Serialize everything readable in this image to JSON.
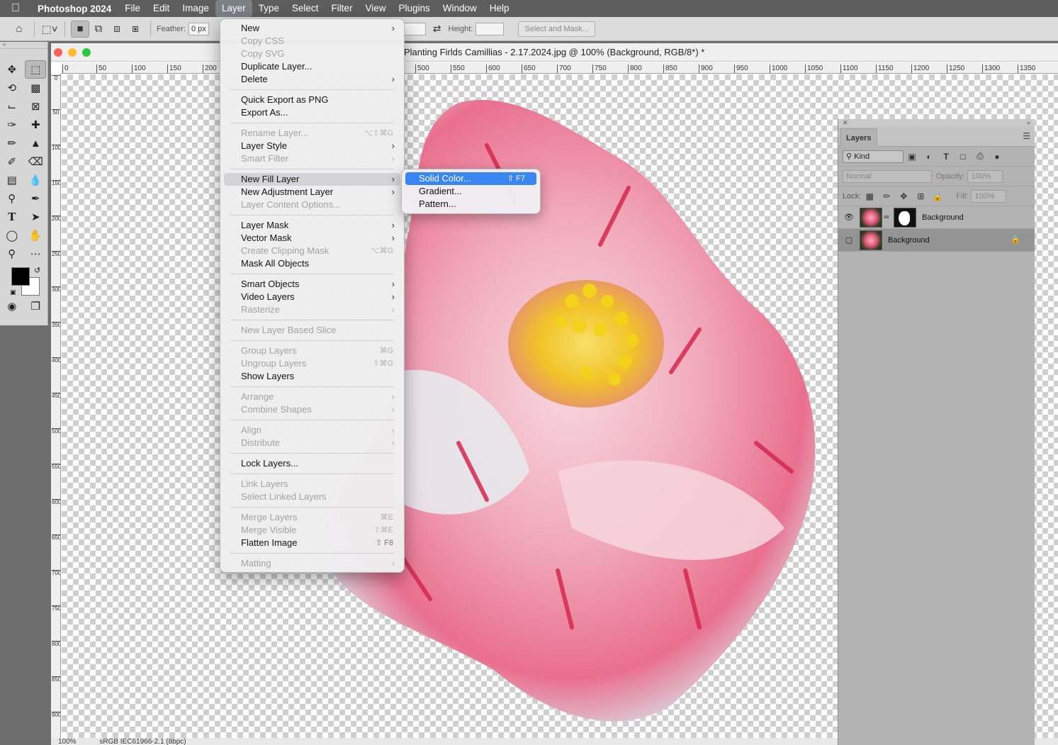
{
  "menubar": {
    "app_name": "Photoshop 2024",
    "items": [
      "File",
      "Edit",
      "Image",
      "Layer",
      "Type",
      "Select",
      "Filter",
      "View",
      "Plugins",
      "Window",
      "Help"
    ],
    "active_item": "Layer"
  },
  "options_bar": {
    "feather_label": "Feather:",
    "feather_value": "0 px",
    "height_label": "Height:",
    "select_mask_label": "Select and Mask..."
  },
  "document": {
    "title": "Planting Firlds Camillias - 2.17.2024.jpg @ 100% (Background, RGB/8*) *",
    "ruler_h": [
      "0",
      "50",
      "100",
      "150",
      "200",
      "500",
      "550",
      "600",
      "650",
      "700",
      "750",
      "800",
      "850",
      "900",
      "950",
      "1000",
      "1050",
      "1100",
      "1150",
      "1200",
      "1250",
      "1300",
      "1350"
    ],
    "ruler_v": [
      "0",
      "50",
      "100",
      "150",
      "200",
      "250",
      "300",
      "350",
      "400",
      "450",
      "500",
      "550",
      "600",
      "650",
      "700",
      "750",
      "800",
      "850",
      "900"
    ],
    "status_zoom": "100%",
    "status_profile": "sRGB IEC61966-2.1 (8bpc)"
  },
  "layer_menu": {
    "groups": [
      [
        {
          "label": "New",
          "arrow": true
        },
        {
          "label": "Copy CSS",
          "disabled": true
        },
        {
          "label": "Copy SVG",
          "disabled": true
        },
        {
          "label": "Duplicate Layer..."
        },
        {
          "label": "Delete",
          "arrow": true
        }
      ],
      [
        {
          "label": "Quick Export as PNG"
        },
        {
          "label": "Export As..."
        }
      ],
      [
        {
          "label": "Rename Layer...",
          "disabled": true,
          "shortcut": "⌥⇧⌘G"
        },
        {
          "label": "Layer Style",
          "arrow": true
        },
        {
          "label": "Smart Filter",
          "disabled": true,
          "arrow": true
        }
      ],
      [
        {
          "label": "New Fill Layer",
          "arrow": true,
          "highlight": true
        },
        {
          "label": "New Adjustment Layer",
          "arrow": true
        },
        {
          "label": "Layer Content Options...",
          "disabled": true
        }
      ],
      [
        {
          "label": "Layer Mask",
          "arrow": true
        },
        {
          "label": "Vector Mask",
          "arrow": true
        },
        {
          "label": "Create Clipping Mask",
          "disabled": true,
          "shortcut": "⌥⌘G"
        },
        {
          "label": "Mask All Objects"
        }
      ],
      [
        {
          "label": "Smart Objects",
          "arrow": true
        },
        {
          "label": "Video Layers",
          "arrow": true
        },
        {
          "label": "Rasterize",
          "disabled": true,
          "arrow": true
        }
      ],
      [
        {
          "label": "New Layer Based Slice",
          "disabled": true
        }
      ],
      [
        {
          "label": "Group Layers",
          "disabled": true,
          "shortcut": "⌘G"
        },
        {
          "label": "Ungroup Layers",
          "disabled": true,
          "shortcut": "⇧⌘G"
        },
        {
          "label": "Show Layers"
        }
      ],
      [
        {
          "label": "Arrange",
          "disabled": true,
          "arrow": true
        },
        {
          "label": "Combine Shapes",
          "disabled": true,
          "arrow": true
        }
      ],
      [
        {
          "label": "Align",
          "disabled": true,
          "arrow": true
        },
        {
          "label": "Distribute",
          "disabled": true,
          "arrow": true
        }
      ],
      [
        {
          "label": "Lock Layers..."
        }
      ],
      [
        {
          "label": "Link Layers",
          "disabled": true
        },
        {
          "label": "Select Linked Layers",
          "disabled": true
        }
      ],
      [
        {
          "label": "Merge Layers",
          "disabled": true,
          "shortcut": "⌘E"
        },
        {
          "label": "Merge Visible",
          "disabled": true,
          "shortcut": "⇧⌘E"
        },
        {
          "label": "Flatten Image",
          "shortcut": "⇧ F8"
        }
      ],
      [
        {
          "label": "Matting",
          "disabled": true,
          "arrow": true
        }
      ]
    ]
  },
  "fill_submenu": {
    "items": [
      {
        "label": "Solid Color...",
        "shortcut": "⇧ F7",
        "highlight": true
      },
      {
        "label": "Gradient..."
      },
      {
        "label": "Pattern..."
      }
    ]
  },
  "layers_panel": {
    "tab": "Layers",
    "kind_label": "Kind",
    "blend_mode": "Normal",
    "opacity_label": "Opacity:",
    "opacity_value": "100%",
    "lock_label": "Lock:",
    "fill_label": "Fill:",
    "fill_value": "100%",
    "layers": [
      {
        "name": "Background",
        "visible": true,
        "has_mask": true,
        "selected": false
      },
      {
        "name": "Background",
        "visible": false,
        "locked": true,
        "selected": true
      }
    ]
  },
  "colors": {
    "menu_highlight": "#3a86f0",
    "flower_pink": "#e35a7a",
    "stamen_yellow": "#f2d21b"
  }
}
